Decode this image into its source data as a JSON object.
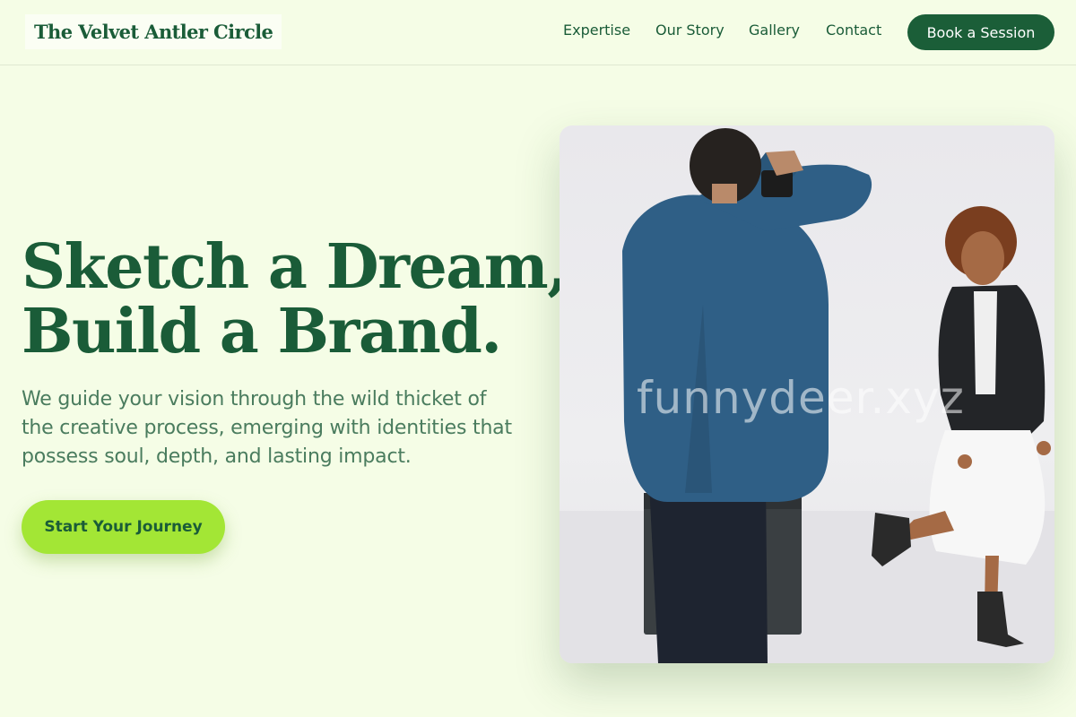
{
  "header": {
    "brand": "The Velvet Antler Circle",
    "nav": [
      "Expertise",
      "Our Story",
      "Gallery",
      "Contact"
    ],
    "cta_label": "Book a Session"
  },
  "hero": {
    "headline_line1": "Sketch a Dream,",
    "headline_line2": "Build a Brand.",
    "subtext": "We guide your vision through the wild thicket of the creative process, emerging with identities that possess soul, depth, and lasting impact.",
    "cta_label": "Start Your Journey",
    "image_watermark": "funnydeer.xyz"
  },
  "colors": {
    "background": "#f5fde6",
    "brand_green": "#1b5e38",
    "accent_lime": "#a3e635",
    "body_text": "#4a7c5e"
  }
}
